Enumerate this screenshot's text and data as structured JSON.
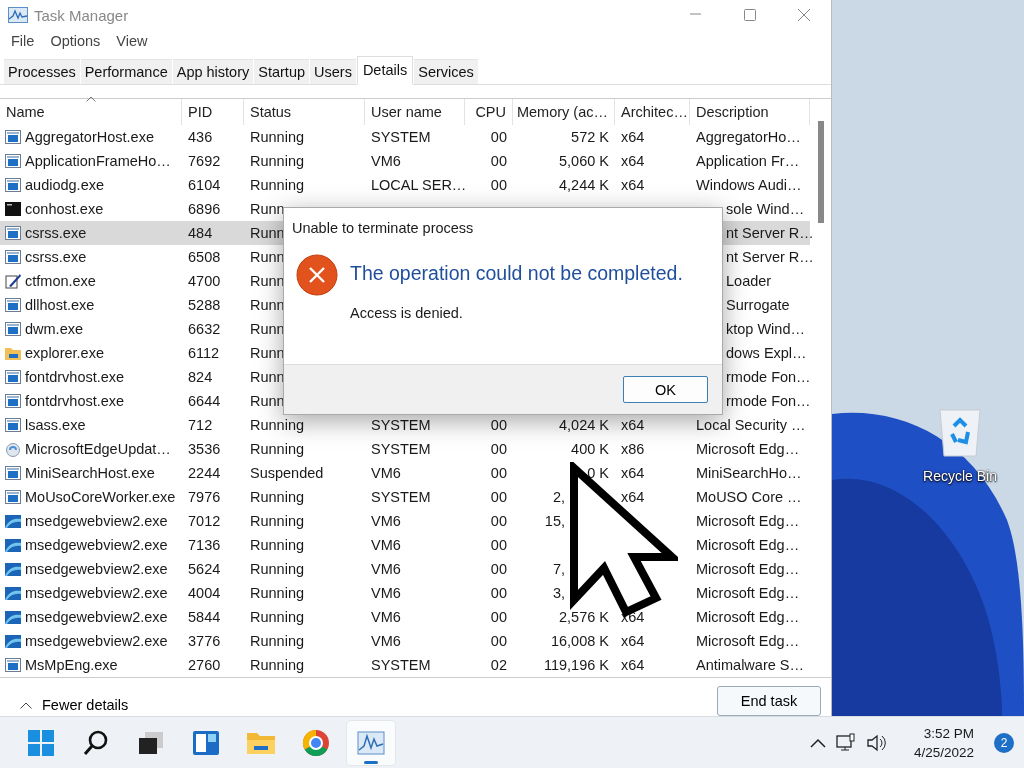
{
  "window": {
    "title": "Task Manager"
  },
  "menu": [
    "File",
    "Options",
    "View"
  ],
  "tabs": [
    {
      "label": "Processes",
      "selected": false
    },
    {
      "label": "Performance",
      "selected": false
    },
    {
      "label": "App history",
      "selected": false
    },
    {
      "label": "Startup",
      "selected": false
    },
    {
      "label": "Users",
      "selected": false
    },
    {
      "label": "Details",
      "selected": true
    },
    {
      "label": "Services",
      "selected": false
    }
  ],
  "table": {
    "columns": [
      "Name",
      "PID",
      "Status",
      "User name",
      "CPU",
      "Memory (ac…",
      "Architec…",
      "Description"
    ],
    "rows": [
      {
        "kind": "app",
        "name": "AggregatorHost.exe",
        "pid": "436",
        "status": "Running",
        "user": "SYSTEM",
        "cpu": "00",
        "memory": "572 K",
        "arch": "x64",
        "description": "AggregatorHo…",
        "selected": false
      },
      {
        "kind": "app",
        "name": "ApplicationFrameHo…",
        "pid": "7692",
        "status": "Running",
        "user": "VM6",
        "cpu": "00",
        "memory": "5,060 K",
        "arch": "x64",
        "description": "Application Fr…",
        "selected": false
      },
      {
        "kind": "app",
        "name": "audiodg.exe",
        "pid": "6104",
        "status": "Running",
        "user": "LOCAL SER…",
        "cpu": "00",
        "memory": "4,244 K",
        "arch": "x64",
        "description": "Windows Audi…",
        "selected": false
      },
      {
        "kind": "console",
        "name": "conhost.exe",
        "pid": "6896",
        "status": "Runn",
        "description": "sole Wind…",
        "selected": false
      },
      {
        "kind": "app",
        "name": "csrss.exe",
        "pid": "484",
        "status": "Runn",
        "description": "nt Server R…",
        "selected": true
      },
      {
        "kind": "app",
        "name": "csrss.exe",
        "pid": "6508",
        "status": "Runn",
        "description": "nt Server R…",
        "selected": false
      },
      {
        "kind": "pen",
        "name": "ctfmon.exe",
        "pid": "4700",
        "status": "Runn",
        "description": "Loader",
        "selected": false
      },
      {
        "kind": "app",
        "name": "dllhost.exe",
        "pid": "5288",
        "status": "Runn",
        "description": "Surrogate",
        "selected": false
      },
      {
        "kind": "app",
        "name": "dwm.exe",
        "pid": "6632",
        "status": "Runn",
        "description": "ktop Wind…",
        "selected": false
      },
      {
        "kind": "folder",
        "name": "explorer.exe",
        "pid": "6112",
        "status": "Runn",
        "description": "dows Expl…",
        "selected": false
      },
      {
        "kind": "app",
        "name": "fontdrvhost.exe",
        "pid": "824",
        "status": "Runn",
        "description": "rmode Fon…",
        "selected": false
      },
      {
        "kind": "app",
        "name": "fontdrvhost.exe",
        "pid": "6644",
        "status": "Runn",
        "description": "rmode Fon…",
        "selected": false
      },
      {
        "kind": "app",
        "name": "lsass.exe",
        "pid": "712",
        "status": "Running",
        "user": "SYSTEM",
        "cpu": "00",
        "memory": "4,024 K",
        "arch": "x64",
        "description": "Local Security …",
        "selected": false
      },
      {
        "kind": "update",
        "name": "MicrosoftEdgeUpdat…",
        "pid": "3536",
        "status": "Running",
        "user": "SYSTEM",
        "cpu": "00",
        "memory": "400 K",
        "arch": "x86",
        "description": "Microsoft Edg…",
        "selected": false
      },
      {
        "kind": "app",
        "name": "MiniSearchHost.exe",
        "pid": "2244",
        "status": "Suspended",
        "user": "VM6",
        "cpu": "00",
        "memory": "0 K",
        "arch": "x64",
        "description": "MiniSearchHo…",
        "selected": false
      },
      {
        "kind": "app",
        "name": "MoUsoCoreWorker.exe",
        "pid": "7976",
        "status": "Running",
        "user": "SYSTEM",
        "cpu": "00",
        "memory": "2,",
        "arch": "x64",
        "description": "MoUSO Core …",
        "selected": false
      },
      {
        "kind": "webview",
        "name": "msedgewebview2.exe",
        "pid": "7012",
        "status": "Running",
        "user": "VM6",
        "cpu": "00",
        "memory": "15,",
        "description": "Microsoft Edg…",
        "selected": false
      },
      {
        "kind": "webview",
        "name": "msedgewebview2.exe",
        "pid": "7136",
        "status": "Running",
        "user": "VM6",
        "cpu": "00",
        "description": "Microsoft Edg…",
        "selected": false
      },
      {
        "kind": "webview",
        "name": "msedgewebview2.exe",
        "pid": "5624",
        "status": "Running",
        "user": "VM6",
        "cpu": "00",
        "memory": "7,",
        "description": "Microsoft Edg…",
        "selected": false
      },
      {
        "kind": "webview",
        "name": "msedgewebview2.exe",
        "pid": "4004",
        "status": "Running",
        "user": "VM6",
        "cpu": "00",
        "memory": "3,",
        "description": "Microsoft Edg…",
        "selected": false
      },
      {
        "kind": "webview",
        "name": "msedgewebview2.exe",
        "pid": "5844",
        "status": "Running",
        "user": "VM6",
        "cpu": "00",
        "memory": "2,576 K",
        "arch": "x64",
        "description": "Microsoft Edg…",
        "selected": false
      },
      {
        "kind": "webview",
        "name": "msedgewebview2.exe",
        "pid": "3776",
        "status": "Running",
        "user": "VM6",
        "cpu": "00",
        "memory": "16,008 K",
        "arch": "x64",
        "description": "Microsoft Edg…",
        "selected": false
      },
      {
        "kind": "app",
        "name": "MsMpEng.exe",
        "pid": "2760",
        "status": "Running",
        "user": "SYSTEM",
        "cpu": "02",
        "memory": "119,196 K",
        "arch": "x64",
        "description": "Antimalware S…",
        "selected": false
      }
    ]
  },
  "footer": {
    "toggle": "Fewer details",
    "button": "End task"
  },
  "dialog": {
    "title": "Unable to terminate process",
    "heading": "The operation could not be completed.",
    "message": "Access is denied.",
    "button": "OK"
  },
  "desktop": {
    "icons": [
      "Recycle Bin"
    ]
  },
  "taskbar": {
    "apps": [
      {
        "kind": "start",
        "selected": false
      },
      {
        "kind": "search",
        "selected": false
      },
      {
        "kind": "taskview",
        "selected": false
      },
      {
        "kind": "widgets",
        "selected": false
      },
      {
        "kind": "folder",
        "selected": false
      },
      {
        "kind": "browser",
        "selected": false
      },
      {
        "kind": "monitor",
        "selected": true
      }
    ],
    "time": "3:52 PM",
    "date": "4/25/2022",
    "notifications": "2"
  }
}
